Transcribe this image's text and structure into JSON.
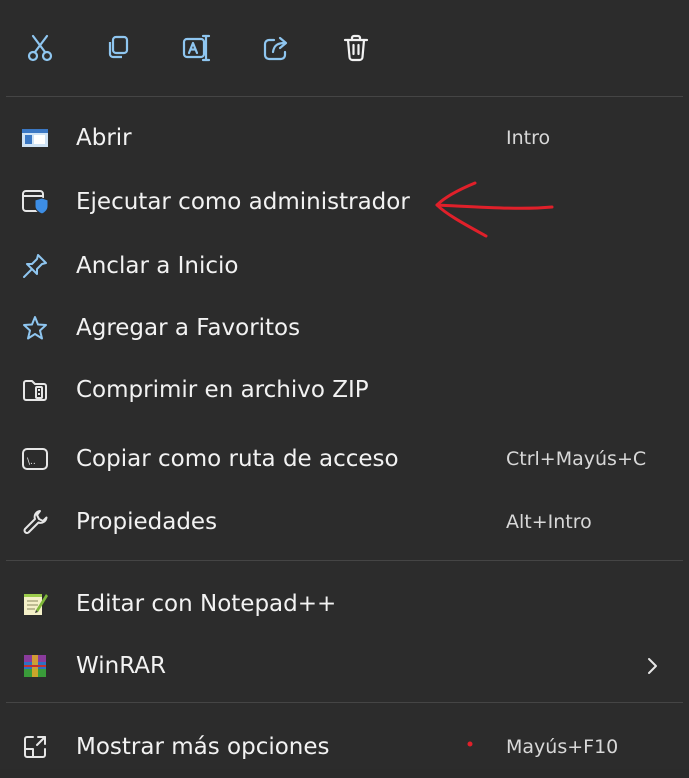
{
  "toolbar": {
    "buttons": [
      {
        "icon": "cut-icon"
      },
      {
        "icon": "copy-icon"
      },
      {
        "icon": "rename-icon"
      },
      {
        "icon": "share-icon"
      },
      {
        "icon": "delete-icon"
      }
    ]
  },
  "menu": {
    "items": [
      {
        "label": "Abrir",
        "shortcut": "Intro",
        "icon": "open-icon"
      },
      {
        "label": "Ejecutar como administrador",
        "shortcut": "",
        "icon": "run-as-admin-icon"
      },
      {
        "label": "Anclar a Inicio",
        "shortcut": "",
        "icon": "pin-icon"
      },
      {
        "label": "Agregar a Favoritos",
        "shortcut": "",
        "icon": "star-icon"
      },
      {
        "label": "Comprimir en archivo ZIP",
        "shortcut": "",
        "icon": "zip-icon"
      },
      {
        "label": "Copiar como ruta de acceso",
        "shortcut": "Ctrl+Mayús+C",
        "icon": "copy-path-icon"
      },
      {
        "label": "Propiedades",
        "shortcut": "Alt+Intro",
        "icon": "wrench-icon"
      },
      {
        "label": "Editar con Notepad++",
        "shortcut": "",
        "icon": "notepadpp-icon"
      },
      {
        "label": "WinRAR",
        "shortcut": "",
        "icon": "winrar-icon",
        "submenu": true
      },
      {
        "label": "Mostrar más opciones",
        "shortcut": "Mayús+F10",
        "icon": "more-options-icon"
      }
    ]
  },
  "colors": {
    "background": "#2c2c2c",
    "separator": "#454545",
    "accent": "#76b9ed",
    "annotation": "#e0202a"
  }
}
